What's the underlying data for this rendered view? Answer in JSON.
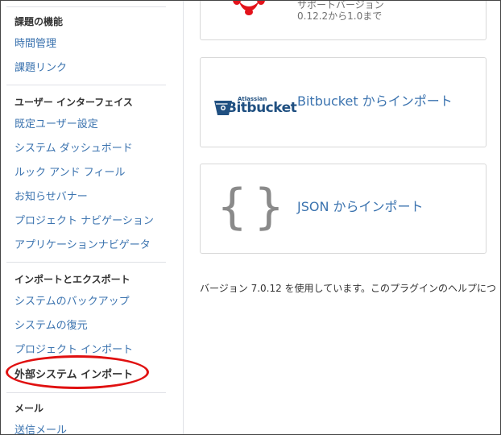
{
  "sidebar": {
    "sections": [
      {
        "heading": "課題の機能",
        "items": [
          {
            "label": "時間管理"
          },
          {
            "label": "課題リンク"
          }
        ]
      },
      {
        "heading": "ユーザー インターフェイス",
        "items": [
          {
            "label": "既定ユーザー設定"
          },
          {
            "label": "システム ダッシュボード"
          },
          {
            "label": "ルック アンド フィール"
          },
          {
            "label": "お知らせバナー"
          },
          {
            "label": "プロジェクト ナビゲーション"
          },
          {
            "label": "アプリケーションナビゲータ"
          }
        ]
      },
      {
        "heading": "インポートとエクスポート",
        "items": [
          {
            "label": "システムのバックアップ"
          },
          {
            "label": "システムの復元"
          },
          {
            "label": "プロジェクト インポート"
          },
          {
            "label": "外部システム インポート",
            "active": true
          }
        ]
      },
      {
        "heading": "メール",
        "items": [
          {
            "label": "送信メール"
          }
        ]
      }
    ]
  },
  "importers": {
    "partial_card": {
      "subtitle_line1": "サポートバージョン",
      "subtitle_line2": "0.12.2から1.0まで",
      "icon": "paw-icon"
    },
    "bitbucket": {
      "brand_small": "Atlassian",
      "brand_name": "Bitbucket",
      "title": "Bitbucket からインポート",
      "icon": "bitbucket-bucket-icon"
    },
    "json": {
      "brace_open": "{",
      "brace_close": "}",
      "title": "JSON からインポート",
      "icon": "curly-braces-icon"
    }
  },
  "footer": {
    "version_text": "バージョン 7.0.12 を使用しています。このプラグインのヘルプにつ"
  },
  "colors": {
    "link": "#3b73af",
    "bitbucket_blue": "#205081",
    "paw_red": "#e3131b",
    "highlight_red": "#e01010"
  }
}
